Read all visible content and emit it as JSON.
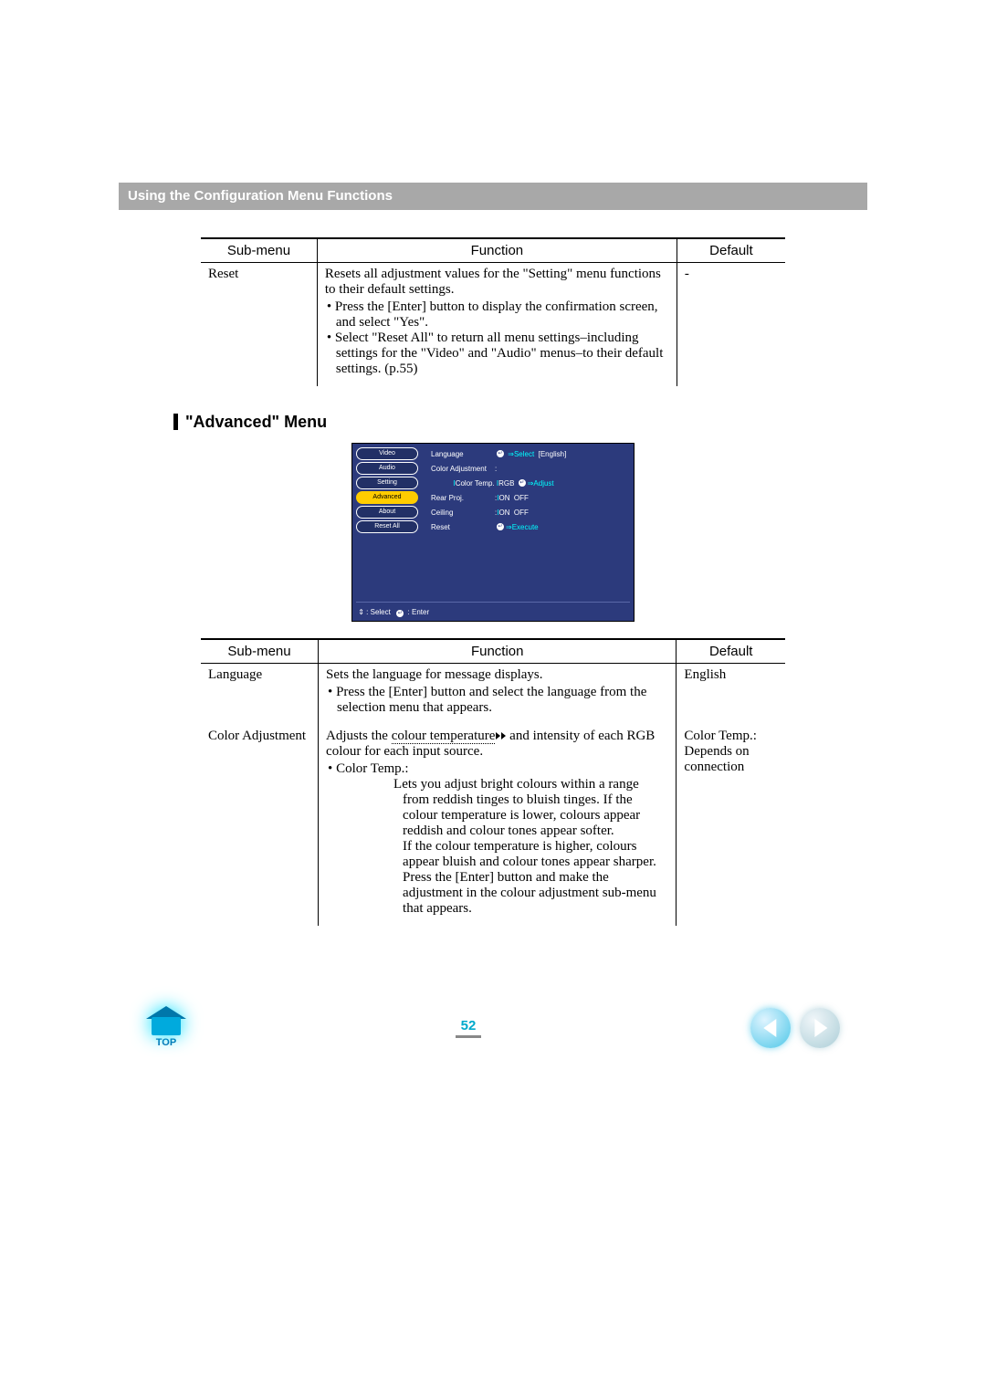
{
  "header": {
    "title": "Using the Configuration Menu Functions"
  },
  "table1": {
    "headers": {
      "submenu": "Sub-menu",
      "function": "Function",
      "default": "Default"
    },
    "row": {
      "submenu": "Reset",
      "intro": "Resets all adjustment values for the \"Setting\" menu functions to their default settings.",
      "b1": "Press the [Enter] button to display the confirmation screen, and select \"Yes\".",
      "b2": "Select \"Reset All\" to return all menu settings–including settings for the \"Video\" and \"Audio\" menus–to their default settings. (p.55)",
      "default": "-"
    }
  },
  "section": {
    "heading": "\"Advanced\" Menu"
  },
  "osd": {
    "left": [
      "Video",
      "Audio",
      "Setting",
      "Advanced",
      "About",
      "Reset All"
    ],
    "right": {
      "language": {
        "label": "Language",
        "value": "[English]",
        "hint": "Select"
      },
      "colorAdj": {
        "label": "Color Adjustment",
        "sub": "Color Temp.",
        "opt": "RGB",
        "hint": "Adjust"
      },
      "rearProj": {
        "label": "Rear Proj.",
        "on": "ON",
        "off": "OFF"
      },
      "ceiling": {
        "label": "Ceiling",
        "on": "ON",
        "off": "OFF"
      },
      "reset": {
        "label": "Reset",
        "hint": "Execute"
      }
    },
    "footer": {
      "select": ": Select",
      "enter": ": Enter"
    },
    "glyphs": {
      "updown": "⇕",
      "enter": "↵"
    }
  },
  "table2": {
    "headers": {
      "submenu": "Sub-menu",
      "function": "Function",
      "default": "Default"
    },
    "row1": {
      "submenu": "Language",
      "intro": "Sets the language for message displays.",
      "b1": "Press the [Enter] button and select the language from the selection menu that appears.",
      "default": "English"
    },
    "row2": {
      "submenu": "Color Adjustment",
      "intro_a": "Adjusts the ",
      "intro_link": "colour temperature",
      "intro_b": " and intensity of each RGB colour for each input source.",
      "b_lead": "Color Temp.:",
      "b_body": "Lets you adjust bright colours within a range from reddish tinges to bluish tinges. If the colour temperature is lower, colours appear reddish and colour tones appear softer.\nIf the colour temperature is higher, colours appear bluish and colour tones appear sharper.\nPress the [Enter] button and make the adjustment in the colour adjustment sub-menu that appears.",
      "default": "Color Temp.: Depends on connection"
    }
  },
  "footer": {
    "topLabel": "TOP",
    "pageNumber": "52"
  }
}
